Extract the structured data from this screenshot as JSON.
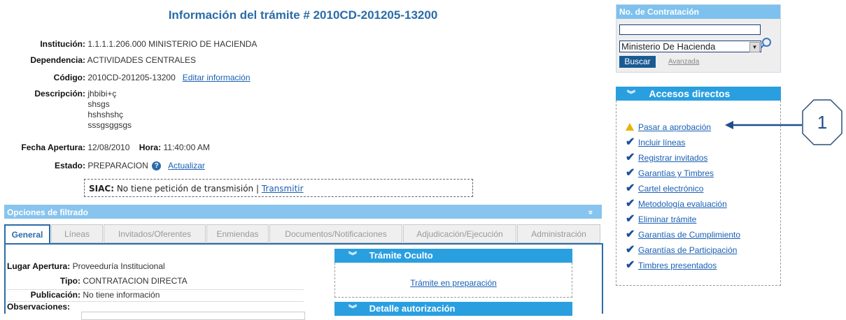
{
  "header": {
    "title": "Información del trámite # 2010CD-201205-13200"
  },
  "info": {
    "institucion_label": "Institución:",
    "institucion_value": "1.1.1.1.206.000   MINISTERIO DE HACIENDA",
    "dependencia_label": "Dependencia:",
    "dependencia_value": "ACTIVIDADES CENTRALES",
    "codigo_label": "Código:",
    "codigo_value": "2010CD-201205-13200",
    "editar_link": "Editar información",
    "descripcion_label": "Descripción:",
    "descripcion_lines": [
      "jhbibi+ç",
      "shsgs",
      "hshshshç",
      "sssgsggsgs"
    ],
    "fecha_label": "Fecha Apertura:",
    "fecha_value": "12/08/2010",
    "hora_label": "Hora:",
    "hora_value": "11:40:00 AM",
    "estado_label": "Estado:",
    "estado_value": "PREPARACION",
    "actualizar_link": "Actualizar"
  },
  "siac": {
    "label": "SIAC:",
    "text": "No tiene petición de transmisión |",
    "link": "Transmitir"
  },
  "filter": {
    "title": "Opciones de filtrado",
    "chevron": "»"
  },
  "tabs": [
    "General",
    "Líneas",
    "Invitados/Oferentes",
    "Enmiendas",
    "Documentos/Notificaciones",
    "Adjudicación/Ejecución",
    "Administración"
  ],
  "general": {
    "lugar_label": "Lugar Apertura:",
    "lugar_value": "Proveeduría Institucional",
    "tipo_label": "Tipo:",
    "tipo_value": "CONTRATACION DIRECTA",
    "publicacion_label": "Publicación:",
    "publicacion_value": "No tiene información",
    "observaciones_label": "Observaciones:"
  },
  "tramite_oculto": {
    "title": "Trámite Oculto",
    "link": "Trámite en preparación"
  },
  "detalle": {
    "title": "Detalle autorización"
  },
  "search": {
    "title": "No. de Contratación",
    "input_value": "",
    "select_value": "Ministerio De Hacienda",
    "button": "Buscar",
    "advanced": "Avanzada"
  },
  "accesos": {
    "title": "Accesos directos",
    "items": [
      "Pasar a aprobación",
      "Incluir líneas",
      "Registrar invitados",
      "Garantías y Timbres",
      "Cartel electrónico",
      "Metodología evaluación",
      "Eliminar trámite",
      "Garantías de Cumplimiento",
      "Garantías de Participación",
      "Timbres presentados"
    ]
  },
  "callout": {
    "number": "1"
  },
  "colors": {
    "accent": "#2a9fe0",
    "title_blue": "#2a6ca8",
    "link": "#1a5fb4",
    "warning": "#e8b400"
  }
}
